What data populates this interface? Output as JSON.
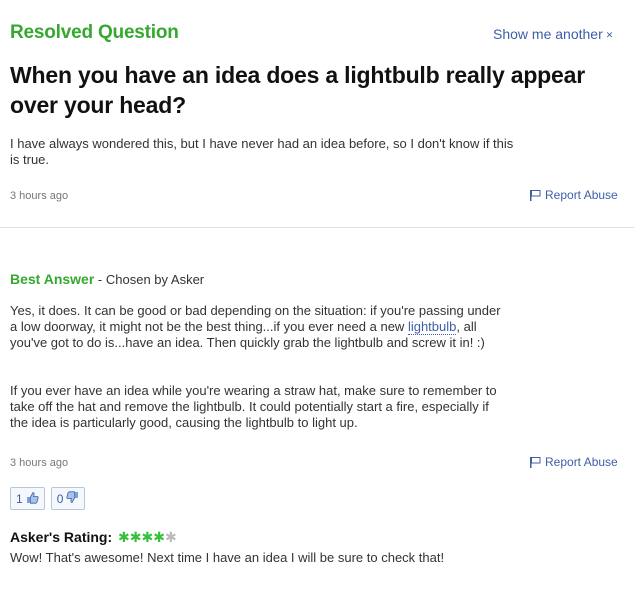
{
  "question": {
    "status": "Resolved Question",
    "show_another": "Show me another",
    "show_another_icon": "close-x-icon",
    "title": "When you have an idea does a lightbulb really appear over your head?",
    "body_line1": "I have always wondered this, but I have never had an idea before, so I don't know if this",
    "body_line2": "is true.",
    "time": "3 hours ago",
    "report": "Report Abuse"
  },
  "answer": {
    "best": "Best Answer",
    "separator": " - ",
    "chosen": "Chosen by Asker",
    "p1_line1": "Yes, it does. It can be good or bad depending on the situation: if you're passing under",
    "p1_line2": "a low doorway, it might not be the best thing...if you ever need a new ",
    "p1_keyword": "lightbulb",
    "p1_line2_end": ", all",
    "p1_line3": "you've got to do is...have an idea. Then quickly grab the lightbulb and screw it in! :)",
    "p2_line1": "If you ever have an idea while you're wearing a straw hat, make sure to remember to",
    "p2_line2": "take off the hat and remove the lightbulb. It could potentially start a fire, especially if",
    "p2_line3": "the idea is particularly good, causing the lightbulb to light up.",
    "time": "3 hours ago",
    "report": "Report Abuse",
    "thumbs_up_count": "1",
    "thumbs_down_count": "0",
    "thumbs_up_icon": "thumbs-up-icon",
    "thumbs_down_icon": "thumbs-down-icon"
  },
  "rating": {
    "label": "Asker's Rating:",
    "stars_filled": 4,
    "stars_total": 5,
    "comment": "Wow! That's awesome! Next time I have an idea I will be sure to check that!"
  },
  "colors": {
    "accent_green": "#36a82f",
    "link_blue": "#3e5ea8",
    "star_green": "#36c03c"
  }
}
